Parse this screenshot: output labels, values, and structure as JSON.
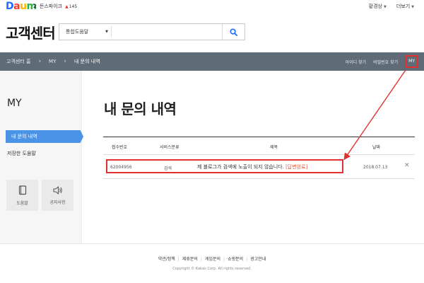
{
  "topbar": {
    "logo": [
      "D",
      "a",
      "u",
      "m"
    ],
    "rank_num": "2",
    "rank_label": "돈스파이크",
    "rank_change": "145",
    "profile": "황경상",
    "more": "더보기"
  },
  "header": {
    "title": "고객센터",
    "search_scope": "통합도움말",
    "search_placeholder": ""
  },
  "navbar": {
    "crumbs": [
      "고객센터 홈",
      "MY",
      "내 문의 내역"
    ],
    "links": [
      "아이디 찾기",
      "비밀번호 찾기"
    ],
    "my": "MY"
  },
  "sidebar": {
    "title": "MY",
    "active_item": "내 문의 내역",
    "item2": "저장한 도움말",
    "card1": "도움말",
    "card2": "공지사항"
  },
  "main": {
    "title": "내 문의 내역",
    "columns": [
      "접수번호",
      "서비스분류",
      "제목",
      "날짜"
    ],
    "rows": [
      {
        "id": "62004956",
        "service": "검색",
        "title": "제 블로그가 검색에 노출이 되지 않습니다.",
        "status": "[답변완료]",
        "date": "2018.07.13",
        "close": "✕"
      }
    ]
  },
  "footer": {
    "links": [
      "약관/정책",
      "제휴문의",
      "게임문의",
      "쇼핑문의",
      "광고안내"
    ],
    "copyright": "Copyright © Kakao Corp. All rights reserved."
  },
  "colors": {
    "navbar": "#5f6b77",
    "active": "#4a93e6",
    "highlight": "#e03131",
    "status": "#e35b3b"
  }
}
